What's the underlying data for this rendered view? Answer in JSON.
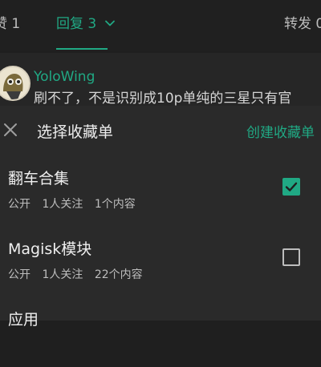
{
  "colors": {
    "accent": "#20a984",
    "background": "#1f1f1f",
    "sheet": "#2a2a2a"
  },
  "tabs": {
    "likes_label": "赞 1",
    "replies_label": "回复 3",
    "forwards_label": "转发 0"
  },
  "comment": {
    "username": "YoloWing",
    "text": "刷不了，不是识别成10p单纯的三星只有官"
  },
  "sheet": {
    "title": "选择收藏单",
    "create_label": "创建收藏单",
    "items": [
      {
        "title": "翻车合集",
        "visibility": "公开",
        "followers": "1人关注",
        "contents": "1个内容",
        "checked": true
      },
      {
        "title": "Magisk模块",
        "visibility": "公开",
        "followers": "1人关注",
        "contents": "22个内容",
        "checked": false
      },
      {
        "title": "应用"
      }
    ]
  },
  "icons": {
    "close": "close-icon",
    "check": "check-icon",
    "chevron": "chevron-down-icon"
  }
}
